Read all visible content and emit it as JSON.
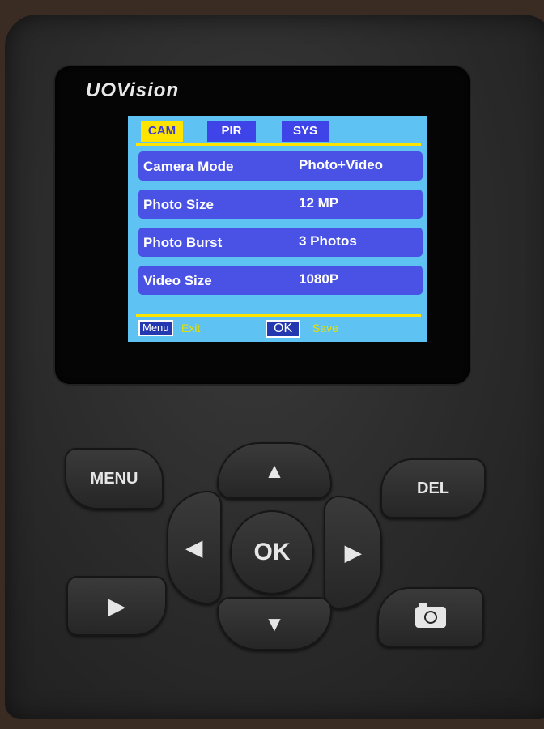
{
  "brand": {
    "logo_text": "UOVision"
  },
  "screen": {
    "tabs": [
      {
        "label": "CAM",
        "active": true
      },
      {
        "label": "PIR",
        "active": false
      },
      {
        "label": "SYS",
        "active": false
      }
    ],
    "settings": [
      {
        "label": "Camera Mode",
        "value": "Photo+Video"
      },
      {
        "label": "Photo Size",
        "value": "12 MP"
      },
      {
        "label": "Photo Burst",
        "value": "3 Photos"
      },
      {
        "label": "Video Size",
        "value": "1080P"
      }
    ],
    "footer": {
      "menu_key": "Menu",
      "menu_hint": "Exit",
      "ok_key": "OK",
      "ok_hint": "Save"
    },
    "colors": {
      "background": "#5ec2f2",
      "row": "#4a52e6",
      "accent": "#ffe400"
    }
  },
  "buttons": {
    "menu": "MENU",
    "del": "DEL",
    "ok": "OK",
    "up": "▲",
    "down": "▼",
    "left": "◀",
    "right": "▶",
    "play": "▶",
    "camera_icon": "camera-icon"
  }
}
